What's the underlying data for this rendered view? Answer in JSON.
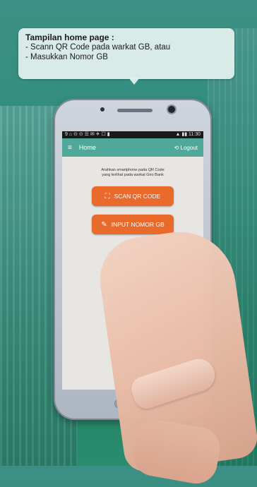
{
  "callout": {
    "title": "Tampilan home page :",
    "line1": "- Scann QR Code pada warkat GB, atau",
    "line2": "- Masukkan Nomor GB"
  },
  "phone": {
    "status": {
      "left": "9 ⌂ ⊙ ⊙ ☰ ✉ ✈ ☐ ▮",
      "right": "▲ ▮▮ 11:30"
    },
    "appbar": {
      "menu_icon": "menu-icon",
      "title": "Home",
      "logout": "Logout"
    },
    "hint": "Arahkan smartphone pada QR Code yang terlihat pada warkat Giro Bank",
    "buttons": {
      "scan": "SCAN QR CODE",
      "input": "INPUT NOMOR GB"
    }
  },
  "colors": {
    "accent_green": "#4fa89a",
    "button_orange": "#ea6a2b",
    "bg_teal": "#2f8f7c"
  }
}
